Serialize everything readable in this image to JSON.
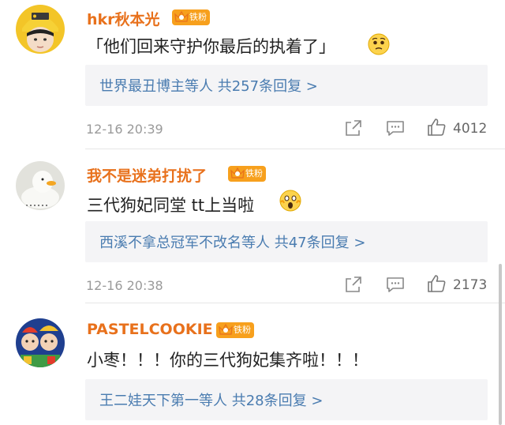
{
  "comments": [
    {
      "username": "hkr秋本光",
      "badge": "铁粉",
      "text": "「他们回来守护你最后的执着了」",
      "emoji_icon": "worried-face-emoji",
      "replies": "世界最丑博主等人 共257条回复 >",
      "time": "12-16 20:39",
      "likes": "4012"
    },
    {
      "username": "我不是迷弟打扰了",
      "badge": "铁粉",
      "text": "三代狗妃同堂 tt上当啦",
      "emoji_icon": "scream-face-emoji",
      "replies": "西溪不拿总冠军不改名等人 共47条回复 >",
      "time": "12-16 20:38",
      "likes": "2173"
    },
    {
      "username": "PASTELCOOKIE",
      "badge": "铁粉",
      "text": "小枣！！！你的三代狗妃集齐啦！！！",
      "replies": "王二娃天下第一等人 共28条回复 >"
    }
  ],
  "colors": {
    "username": "#e8711c",
    "reply_link": "#4a7cb0",
    "badge": "#f7a01d",
    "reply_bg": "#f4f4f6"
  },
  "icons": {
    "share": "share-icon",
    "comment": "comment-icon",
    "like": "thumbs-up-icon",
    "crown": "crown-icon"
  }
}
